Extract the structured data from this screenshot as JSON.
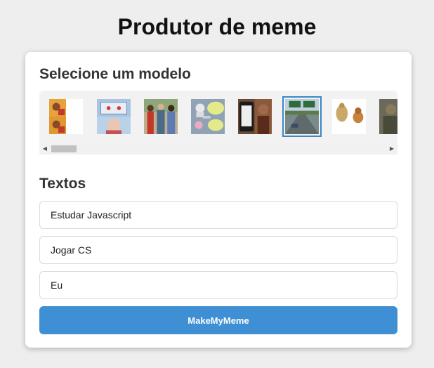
{
  "header": {
    "title": "Produtor de meme"
  },
  "templates": {
    "title": "Selecione um modelo",
    "selected_index": 5,
    "items": [
      {
        "name": "drake-template-icon"
      },
      {
        "name": "two-panel-template-icon"
      },
      {
        "name": "distracted-boyfriend-template-icon"
      },
      {
        "name": "cartoon-template-icon"
      },
      {
        "name": "uno-draw-card-template-icon"
      },
      {
        "name": "left-exit-highway-template-icon"
      },
      {
        "name": "gold-figure-template-icon"
      },
      {
        "name": "partial-template-icon"
      }
    ],
    "scroll": {
      "left_arrow": "◀",
      "right_arrow": "▶"
    }
  },
  "texts": {
    "title": "Textos",
    "fields": [
      {
        "value": "Estudar Javascript"
      },
      {
        "value": "Jogar CS"
      },
      {
        "value": "Eu"
      }
    ]
  },
  "action": {
    "label": "MakeMyMeme"
  },
  "colors": {
    "accent": "#3e8fd3",
    "selected_border": "#3b87c8",
    "background": "#eeeeee"
  }
}
